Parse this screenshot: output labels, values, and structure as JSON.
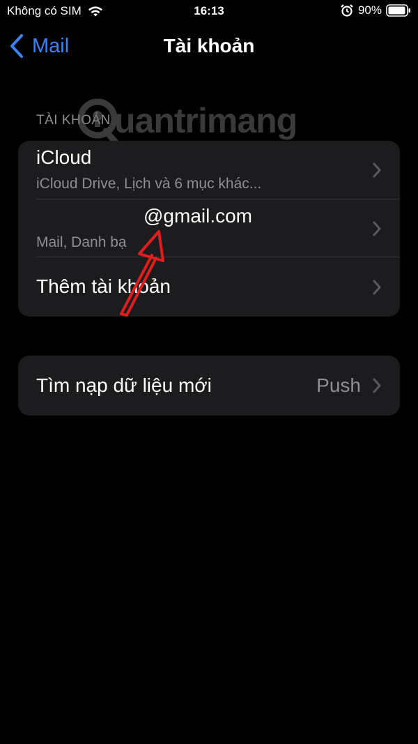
{
  "status_bar": {
    "carrier": "Không có SIM",
    "time": "16:13",
    "battery_percent": "90%"
  },
  "nav": {
    "back_label": "Mail",
    "title": "Tài khoản"
  },
  "accounts_section": {
    "header": "TÀI KHOẢN",
    "rows": [
      {
        "title": "iCloud",
        "subtitle": "iCloud Drive, Lịch và 6 mục khác..."
      },
      {
        "title": "@gmail.com",
        "subtitle": "Mail, Danh bạ"
      },
      {
        "title": "Thêm tài khoản"
      }
    ]
  },
  "fetch_section": {
    "title": "Tìm nạp dữ liệu mới",
    "value": "Push"
  },
  "watermark": {
    "text": "uantrimang"
  },
  "colors": {
    "background": "#000000",
    "cell_background": "#1c1c1e",
    "accent_blue": "#3b82f6",
    "secondary_text": "#8e8e93",
    "annotation_red": "#e11d1d"
  },
  "icons": {
    "wifi": "wifi-icon",
    "alarm": "alarm-icon",
    "battery": "battery-icon",
    "back": "chevron-left-icon",
    "disclosure": "chevron-right-icon"
  }
}
